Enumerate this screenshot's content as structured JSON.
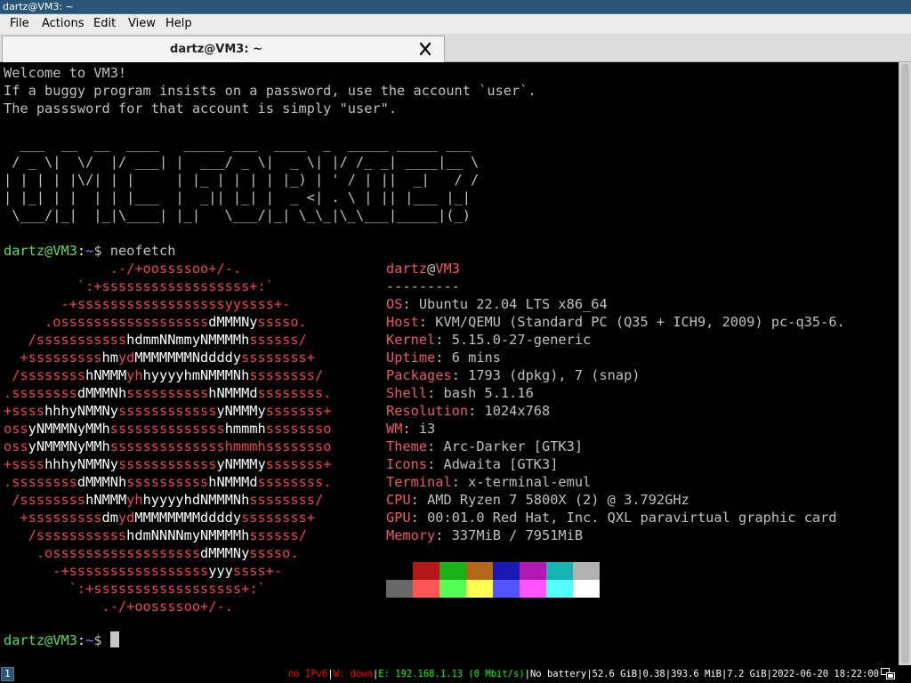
{
  "window": {
    "title": "dartz@VM3: ~"
  },
  "menu": [
    "File",
    "Actions",
    "Edit",
    "View",
    "Help"
  ],
  "tab": {
    "label": "dartz@VM3: ~"
  },
  "terminal": {
    "welcome": [
      "Welcome to VM3!",
      "If a buggy program insists on a password, use the account `user`.",
      "The passsword for that account is simply \"user\"."
    ],
    "banner": [
      "  ___  __  __  ____   _____ ___  ____  _  _____ _____ ___",
      " / _ \\|  \\/  |/ ___| |  ___/ _ \\|  _ \\| |/ /_ _| ____|__ \\",
      "| | | | |\\/| | |     | |_ | | | | |_) | ' / | ||  _|   / /",
      "| |_| | |  | | |___  |  _|| |_| |  _ <| . \\ | || |___ |_|",
      " \\___/|_|  |_|\\____| |_|   \\___/|_| \\_\\_|\\_\\___|_____|(_)"
    ],
    "prompt": {
      "user": "dartz@VM3",
      "sep": ":",
      "path": "~",
      "sym": "$ "
    },
    "command": "neofetch",
    "logo": [
      [
        [
          "r",
          "             .-/+oossssoo+/-."
        ]
      ],
      [
        [
          "r",
          "         `:+ssssssssssssssssss+:`"
        ]
      ],
      [
        [
          "r",
          "       -+ssssssssssssssssssyyssss+-"
        ]
      ],
      [
        [
          "r",
          "     .ossssssssssssssssss"
        ],
        [
          "w",
          "dMMMNy"
        ],
        [
          "r",
          "sssso."
        ]
      ],
      [
        [
          "r",
          "   /sssssssssss"
        ],
        [
          "w",
          "hdmmNNmmyNMMMMh"
        ],
        [
          "r",
          "ssssss/"
        ]
      ],
      [
        [
          "r",
          "  +sssssssss"
        ],
        [
          "w",
          "hm"
        ],
        [
          "r",
          "yd"
        ],
        [
          "w",
          "MMMMMMMNddddy"
        ],
        [
          "r",
          "ssssssss+"
        ]
      ],
      [
        [
          "r",
          " /ssssssss"
        ],
        [
          "w",
          "hNMMM"
        ],
        [
          "r",
          "yh"
        ],
        [
          "w",
          "hyyyyhmNMMMNh"
        ],
        [
          "r",
          "ssssssss/"
        ]
      ],
      [
        [
          "r",
          ".ssssssss"
        ],
        [
          "w",
          "dMMMNh"
        ],
        [
          "r",
          "ssssssssss"
        ],
        [
          "w",
          "hNMMMd"
        ],
        [
          "r",
          "ssssssss."
        ]
      ],
      [
        [
          "r",
          "+ssss"
        ],
        [
          "w",
          "hhhyNMMNy"
        ],
        [
          "r",
          "ssssssssssss"
        ],
        [
          "w",
          "yNMMMy"
        ],
        [
          "r",
          "sssssss+"
        ]
      ],
      [
        [
          "r",
          "oss"
        ],
        [
          "w",
          "yNMMMNyMMh"
        ],
        [
          "r",
          "ssssssssssssss"
        ],
        [
          "w",
          "hmmmh"
        ],
        [
          "r",
          "ssssssso"
        ]
      ],
      [
        [
          "r",
          "oss"
        ],
        [
          "w",
          "yNMMMNyMMh"
        ],
        [
          "r",
          "sssssssssssssshmmmhssssssso"
        ]
      ],
      [
        [
          "r",
          "+ssss"
        ],
        [
          "w",
          "hhhyNMMNy"
        ],
        [
          "r",
          "ssssssssssss"
        ],
        [
          "w",
          "yNMMMy"
        ],
        [
          "r",
          "sssssss+"
        ]
      ],
      [
        [
          "r",
          ".ssssssss"
        ],
        [
          "w",
          "dMMMNh"
        ],
        [
          "r",
          "ssssssssss"
        ],
        [
          "w",
          "hNMMMd"
        ],
        [
          "r",
          "ssssssss."
        ]
      ],
      [
        [
          "r",
          " /ssssssss"
        ],
        [
          "w",
          "hNMMM"
        ],
        [
          "r",
          "yh"
        ],
        [
          "w",
          "hyyyyhdNMMMNh"
        ],
        [
          "r",
          "ssssssss/"
        ]
      ],
      [
        [
          "r",
          "  +sssssssss"
        ],
        [
          "w",
          "dm"
        ],
        [
          "r",
          "yd"
        ],
        [
          "w",
          "MMMMMMMMddddy"
        ],
        [
          "r",
          "ssssssss+"
        ]
      ],
      [
        [
          "r",
          "   /sssssssssss"
        ],
        [
          "w",
          "hdmNNNNmyNMMMMh"
        ],
        [
          "r",
          "ssssss/"
        ]
      ],
      [
        [
          "r",
          "    .ossssssssssssssssss"
        ],
        [
          "w",
          "dMMMNy"
        ],
        [
          "r",
          "sssso."
        ]
      ],
      [
        [
          "r",
          "      -+sssssssssssssssss"
        ],
        [
          "w",
          "yyy"
        ],
        [
          "r",
          "ssss+-"
        ]
      ],
      [
        [
          "r",
          "        `:+ssssssssssssssssss+:`"
        ]
      ],
      [
        [
          "r",
          "            .-/+oossssoo+/-."
        ]
      ]
    ],
    "info_header": {
      "user": "dartz",
      "at": "@",
      "host": "VM3"
    },
    "info_sep": "---------",
    "info": [
      {
        "key": "OS",
        "value": "Ubuntu 22.04 LTS x86_64"
      },
      {
        "key": "Host",
        "value": "KVM/QEMU (Standard PC (Q35 + ICH9, 2009) pc-q35-6."
      },
      {
        "key": "Kernel",
        "value": "5.15.0-27-generic"
      },
      {
        "key": "Uptime",
        "value": "6 mins"
      },
      {
        "key": "Packages",
        "value": "1793 (dpkg), 7 (snap)"
      },
      {
        "key": "Shell",
        "value": "bash 5.1.16"
      },
      {
        "key": "Resolution",
        "value": "1024x768"
      },
      {
        "key": "WM",
        "value": "i3"
      },
      {
        "key": "Theme",
        "value": "Arc-Darker [GTK3]"
      },
      {
        "key": "Icons",
        "value": "Adwaita [GTK3]"
      },
      {
        "key": "Terminal",
        "value": "x-terminal-emul"
      },
      {
        "key": "CPU",
        "value": "AMD Ryzen 7 5800X (2) @ 3.792GHz"
      },
      {
        "key": "GPU",
        "value": "00:01.0 Red Hat, Inc. QXL paravirtual graphic card"
      },
      {
        "key": "Memory",
        "value": "337MiB / 7951MiB"
      }
    ],
    "palette_row1": [
      "#000000",
      "#b21818",
      "#18b218",
      "#b26818",
      "#1818b2",
      "#b218b2",
      "#18b2b2",
      "#b2b2b2"
    ],
    "palette_row2": [
      "#686868",
      "#ff5454",
      "#54ff54",
      "#ffff54",
      "#5454ff",
      "#ff54ff",
      "#54ffff",
      "#ffffff"
    ]
  },
  "statusbar": {
    "workspace": "1",
    "ipv6": "no IPv6",
    "wifi": "W: down",
    "eth": "E: 192.168.1.13 (0 Mbit/s)",
    "battery": "No battery",
    "disk": "52.6 GiB",
    "load": "0.38",
    "mem_used": "393.6 MiB",
    "mem_total": "7.2 GiB",
    "datetime": "2022-06-20 18:22:00",
    "sep": "|",
    "colors": {
      "bad": "#ff0000",
      "good": "#00ff00",
      "neutral": "#ffffff"
    }
  }
}
